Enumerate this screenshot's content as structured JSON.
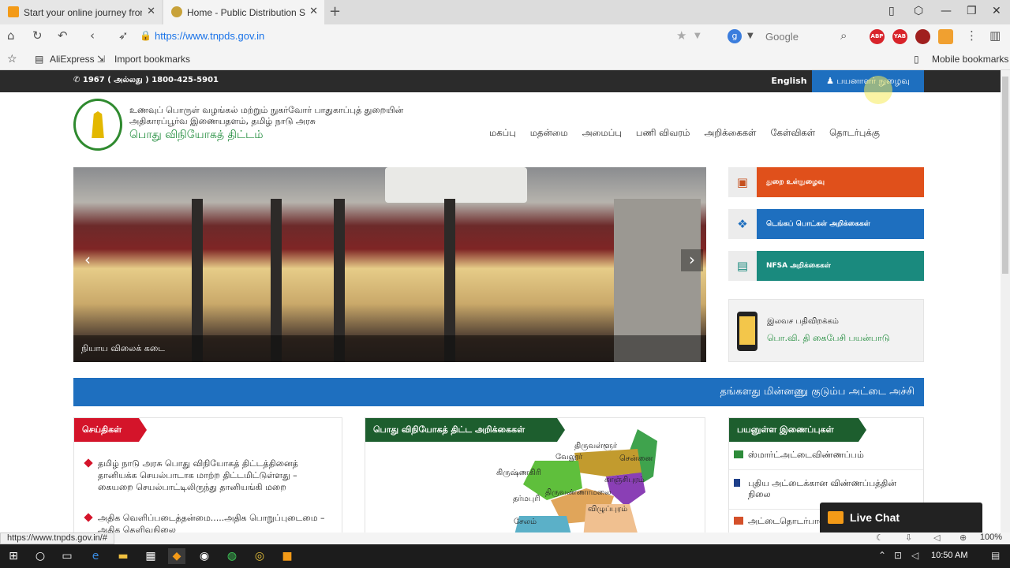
{
  "browser": {
    "tabs": [
      {
        "title": "Start your online journey from"
      },
      {
        "title": "Home - Public Distribution Sy"
      }
    ],
    "url": "https://www.tnpds.gov.in",
    "search_placeholder": "Google",
    "extensions": [
      "ABP",
      "YAB"
    ],
    "bookmarks": [
      "AliExpress",
      "Import bookmarks"
    ],
    "mobile_bookmarks": "Mobile bookmarks",
    "status_url": "https://www.tnpds.gov.in/#",
    "zoom": "100%"
  },
  "site": {
    "helpline": "1967 ( அல்லது ) 1800-425-5901",
    "language": "English",
    "login": "பயனாளர் நுழைவு",
    "department": "உணவுப் பொருள் வழங்கல் மற்றும் நுகர்வோர் பாதுகாப்புத் துறையின் அதிகாரப்பூர்வ இணையதளம், தமிழ் நாடு அரசு",
    "name": "பொது விநியோகத் திட்டம்",
    "nav": [
      "மகப்பு",
      "மதன்மை",
      "அமைப்பு",
      "பணி விவரம்",
      "அறிக்கைகள்",
      "கேள்விகள்",
      "தொடர்புக்கு"
    ],
    "slider_caption": "நியாய விலைக் கடை",
    "quick_links": [
      "துறை உள்நுழைவு",
      "டெங்கப் பொட்கள் அறிக்கைகள்",
      "NFSA அறிக்கைகள்"
    ],
    "quick_link_colors": [
      "#e0501b",
      "#1e6fbf",
      "#1a8a7e"
    ],
    "app_title": "இலவச பதிவிறக்கம்",
    "app_name": "பொ.வி. தி கைபேசி பயன்பாடு",
    "banner": "தங்களது மின்னணு குடும்ப அட்டை அச்சி",
    "news_title": "செய்திகள்",
    "news": [
      "தமிழ் நாடு அரசு பொது விநியோகத் திட்டத்தினைத் தானியக்க செயல்பாடாக மாற்ற திட்டமிட்டுள்ளது – கையறை செயல்பாட்டிலிருந்து தானியங்கி மறை",
      "அதிக வெளிப்படைத்தன்மை.....அதிக பொறுப்புடைமை – அதிக தெளிவுநிலை"
    ],
    "map_title": "பொது விநியோகத் திட்ட அறிக்கைகள்",
    "districts": [
      "திருவள்ளூர்",
      "வேலூர்",
      "சென்னை",
      "கிருஷ்ணகிரி",
      "காஞ்சிபுரம்",
      "தர்மபுரி",
      "திருவண்ணாமலை",
      "விழுப்புரம்",
      "சேலம்"
    ],
    "useful_links_title": "பயனுள்ள இணைப்புகள்",
    "useful_links": [
      "ஸ்மார்ட்அட்டைவிண்ணப்பம்",
      "புதிய அட்டைக்கான விண்ணப்பத்தின் நிலை",
      "அட்டைதொடர்பான"
    ],
    "live_chat": "Live Chat"
  },
  "taskbar": {
    "time": "10:50 AM"
  }
}
